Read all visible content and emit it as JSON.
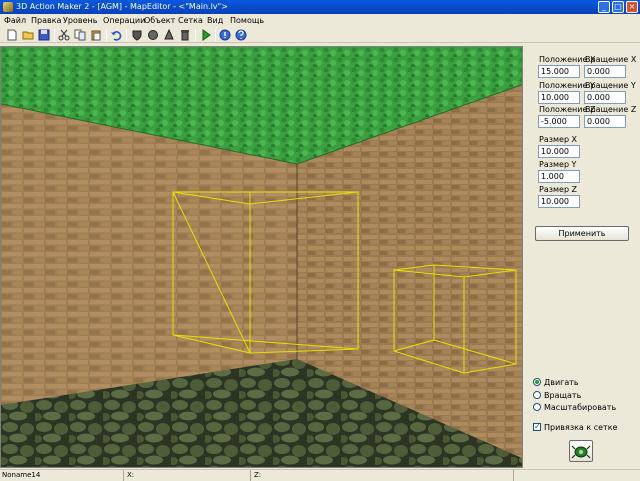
{
  "window": {
    "title": "3D Action Maker 2 - [AGM] - MapEditor - <\"Main.lv\">",
    "min_glyph": "_",
    "max_glyph": "□",
    "close_glyph": "×"
  },
  "menu": {
    "items": [
      "Файл",
      "Правка",
      "Уровень",
      "Операции",
      "Объект",
      "Сетка",
      "Вид",
      "Помощь"
    ]
  },
  "toolbar": {
    "buttons": [
      {
        "icon": "new-file-icon"
      },
      {
        "icon": "open-folder-icon"
      },
      {
        "icon": "save-icon"
      },
      {
        "icon": "cut-icon"
      },
      {
        "icon": "copy-icon"
      },
      {
        "icon": "paste-icon"
      },
      {
        "icon": "undo-icon"
      },
      {
        "icon": "shield-icon"
      },
      {
        "icon": "sphere-icon"
      },
      {
        "icon": "cone-icon"
      },
      {
        "icon": "trash-icon"
      },
      {
        "icon": "play-icon"
      },
      {
        "icon": "help-icon"
      },
      {
        "icon": "about-icon"
      }
    ]
  },
  "panel": {
    "pos_x_label": "Положение X",
    "pos_x_value": "15.000",
    "rot_x_label": "Вращение X",
    "rot_x_value": "0.000",
    "pos_y_label": "Положение Y",
    "pos_y_value": "10.000",
    "rot_y_label": "Вращение Y",
    "rot_y_value": "0.000",
    "pos_z_label": "Положение Z",
    "pos_z_value": "-5.000",
    "rot_z_label": "Вращение Z",
    "rot_z_value": "0.000",
    "size_x_label": "Размер X",
    "size_x_value": "10.000",
    "size_y_label": "Размер Y",
    "size_y_value": "1.000",
    "size_z_label": "Размер Z",
    "size_z_value": "10.000",
    "apply_label": "Применить",
    "mode_move": "Двигать",
    "mode_rotate": "Вращать",
    "mode_scale": "Масштабировать",
    "selected_mode": "Двигать",
    "snap_label": "Привязка к сетке",
    "snap_checked": true,
    "check_glyph": "✓"
  },
  "status": {
    "name": "Noname14",
    "x_label": "X:",
    "z_label": "Z:"
  },
  "colors": {
    "selection_outline": "#e8e000",
    "ceiling_green": "#3a9a3a",
    "brick": "#9a7a52",
    "floor": "#4a5a38"
  }
}
